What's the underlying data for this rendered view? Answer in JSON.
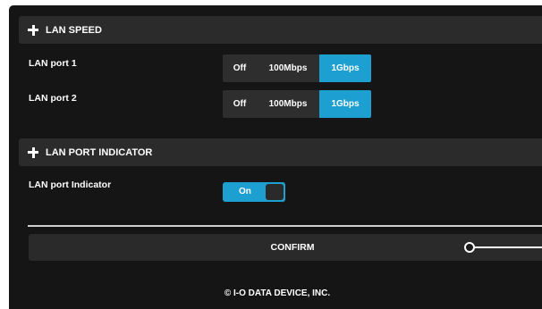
{
  "lan_speed": {
    "header": "LAN SPEED",
    "ports": [
      {
        "label": "LAN port 1",
        "options": [
          "Off",
          "100Mbps",
          "1Gbps"
        ],
        "selected": "1Gbps"
      },
      {
        "label": "LAN port 2",
        "options": [
          "Off",
          "100Mbps",
          "1Gbps"
        ],
        "selected": "1Gbps"
      }
    ]
  },
  "lan_port_indicator": {
    "header": "LAN PORT INDICATOR",
    "label": "LAN port Indicator",
    "toggle_label": "On",
    "toggle_state": true
  },
  "confirm_label": "CONFIRM",
  "footer": "© I-O DATA DEVICE, INC.",
  "colors": {
    "accent": "#1e9fd2",
    "background": "#151515",
    "panel": "#2b2b2b"
  },
  "icons": {
    "section_expand": "plus-icon"
  }
}
